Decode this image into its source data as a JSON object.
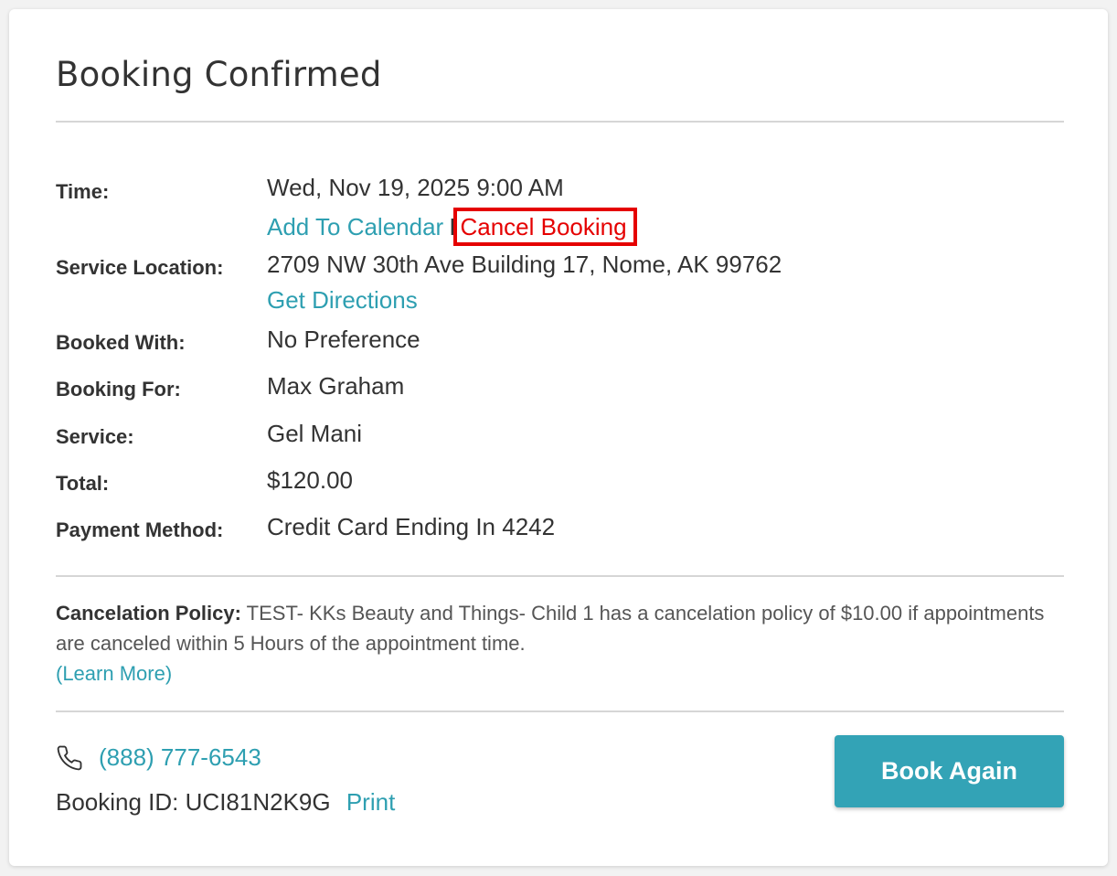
{
  "page": {
    "title": "Booking Confirmed"
  },
  "details": {
    "time": {
      "label": "Time:",
      "value": "Wed, Nov 19, 2025 9:00 AM",
      "add_to_calendar": "Add To Calendar",
      "separator": "I",
      "cancel_booking": "Cancel Booking"
    },
    "location": {
      "label": "Service Location:",
      "value": "2709 NW 30th Ave Building 17, Nome, AK 99762",
      "directions": "Get Directions"
    },
    "booked_with": {
      "label": "Booked With:",
      "value": "No Preference"
    },
    "booking_for": {
      "label": "Booking For:",
      "value": "Max Graham"
    },
    "service": {
      "label": "Service:",
      "value": "Gel Mani"
    },
    "total": {
      "label": "Total:",
      "value": "$120.00"
    },
    "payment": {
      "label": "Payment Method:",
      "value": "Credit Card Ending In 4242"
    }
  },
  "policy": {
    "label": "Cancelation Policy:",
    "text": "TEST- KKs Beauty and Things- Child 1 has a cancelation policy of $10.00 if appointments are canceled within 5 Hours of the appointment time.",
    "learn_more": "(Learn More)"
  },
  "footer": {
    "phone_icon": "phone-icon",
    "phone": "(888) 777-6543",
    "booking_id_label": "Booking ID:",
    "booking_id": "UCI81N2K9G",
    "print": "Print",
    "book_again": "Book Again"
  },
  "colors": {
    "link": "#2e9fb1",
    "cancel_highlight": "#e50000",
    "button": "#33a3b6"
  }
}
